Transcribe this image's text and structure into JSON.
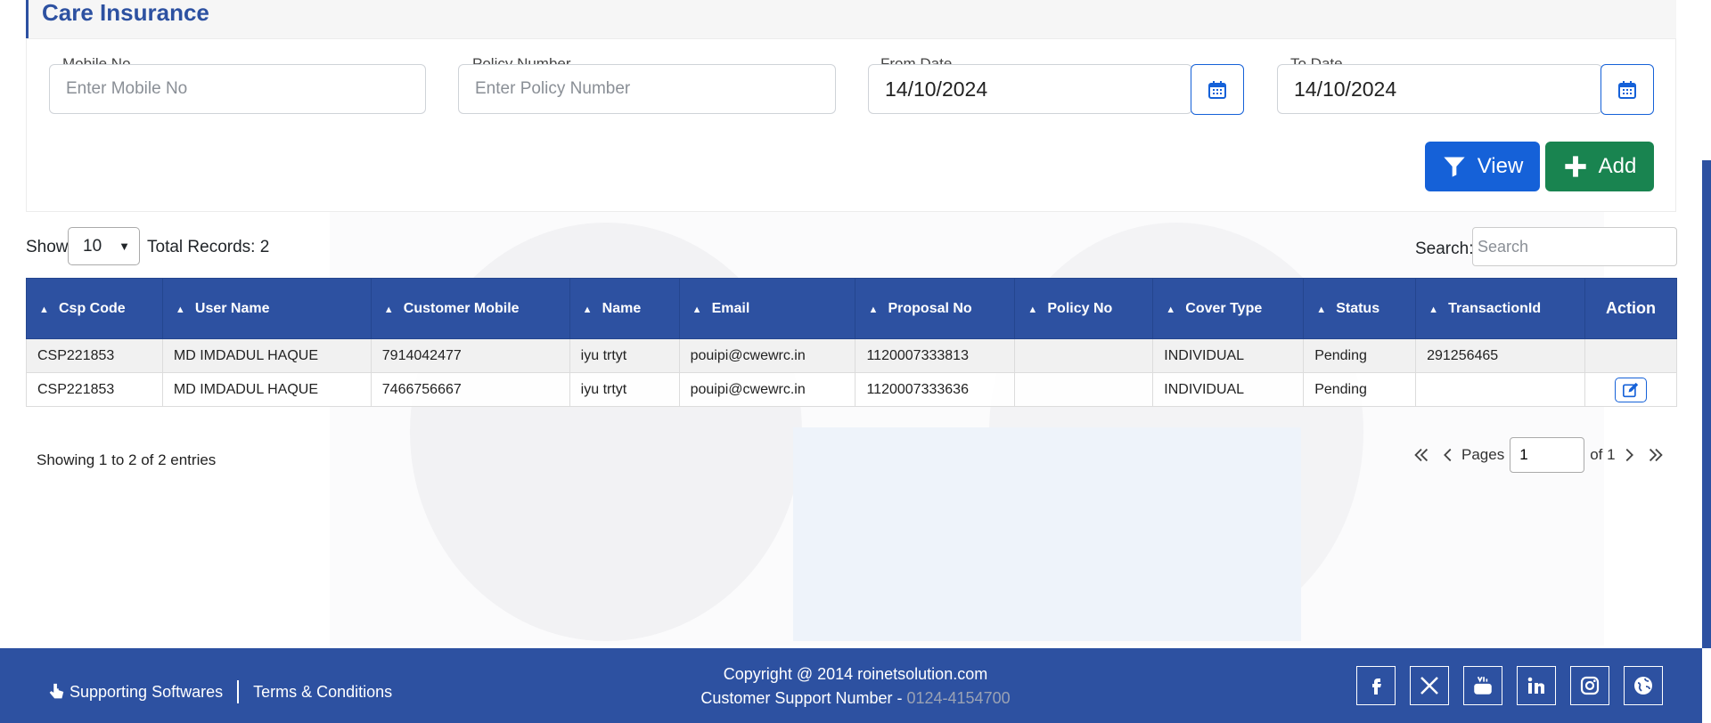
{
  "panel": {
    "title": "Care Insurance"
  },
  "filters": {
    "mobile_label": "Mobile No",
    "mobile_placeholder": "Enter Mobile No",
    "mobile_value": "",
    "policy_label": "Policy Number",
    "policy_placeholder": "Enter Policy Number",
    "policy_value": "",
    "from_label": "From Date",
    "from_value": "14/10/2024",
    "to_label": "To Date",
    "to_value": "14/10/2024",
    "view_label": "View",
    "add_label": "Add"
  },
  "list": {
    "show_label": "Show",
    "page_size": "10",
    "total_label": "Total Records: 2",
    "search_label": "Search:",
    "search_placeholder": "Search"
  },
  "table": {
    "columns": [
      "Csp Code",
      "User Name",
      "Customer Mobile",
      "Name",
      "Email",
      "Proposal No",
      "Policy No",
      "Cover Type",
      "Status",
      "TransactionId",
      "Action"
    ],
    "rows": [
      [
        "CSP221853",
        "MD IMDADUL HAQUE",
        "7914042477",
        "iyu trtyt",
        "pouipi@cwewrc.in",
        "1120007333813",
        "",
        "INDIVIDUAL",
        "Pending",
        "291256465"
      ],
      [
        "CSP221853",
        "MD IMDADUL HAQUE",
        "7466756667",
        "iyu trtyt",
        "pouipi@cwewrc.in",
        "1120007333636",
        "",
        "INDIVIDUAL",
        "Pending",
        ""
      ]
    ],
    "row_actions": [
      "",
      "edit-icon"
    ]
  },
  "pagination": {
    "showing": "Showing 1 to 2 of 2 entries",
    "pages_label": "Pages",
    "current_page": "1",
    "of_label": "of 1"
  },
  "footer": {
    "supporting": "Supporting Softwares",
    "terms": "Terms & Conditions",
    "copyright": "Copyright @ 2014 roinetsolution.com",
    "support_label": "Customer Support Number - ",
    "support_number": "0124-4154700",
    "social": [
      "facebook-icon",
      "x-icon",
      "youtube-icon",
      "linkedin-icon",
      "instagram-icon",
      "globe-icon"
    ]
  },
  "colors": {
    "primary": "#2d51a1",
    "button_blue": "#1561d8",
    "button_green": "#198450"
  }
}
